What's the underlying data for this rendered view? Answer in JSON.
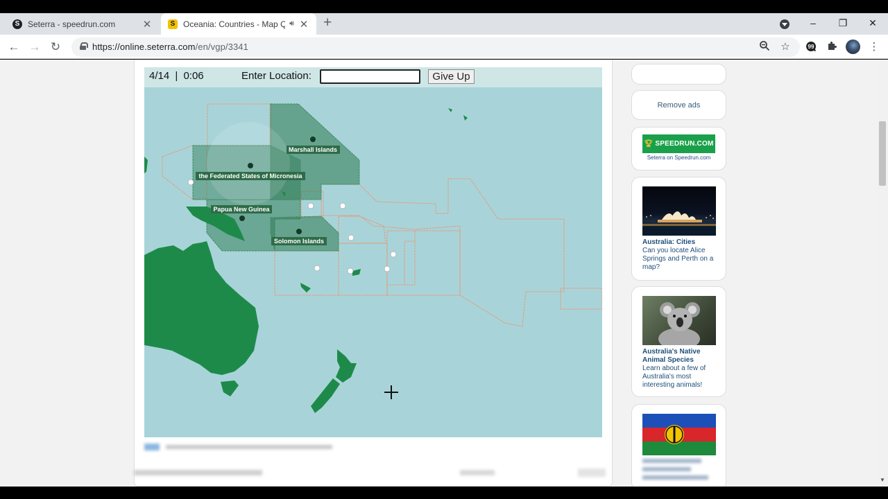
{
  "browser": {
    "tabs": [
      {
        "title": "Seterra - speedrun.com",
        "favicon": "speedrun-favicon-icon",
        "active": false
      },
      {
        "title": "Oceania: Countries - Map Qu",
        "favicon": "seterra-favicon-icon",
        "active": true
      }
    ],
    "url_domain": "https://online.seterra.com",
    "url_path": "/en/vgp/3341",
    "new_tab_glyph": "+",
    "window_controls": [
      "–",
      "❐",
      "✕"
    ]
  },
  "game": {
    "progress": "4/14",
    "separator": "|",
    "timer": "0:06",
    "enter_location_label": "Enter Location:",
    "location_value": "",
    "give_up_label": "Give Up",
    "map": {
      "ocean_color": "#a8d4d9",
      "land_color": "#1e8a4a",
      "answered_fill": "#2e7a52",
      "labels": [
        {
          "name": "Marshall Islands"
        },
        {
          "name": "the Federated States of Micronesia"
        },
        {
          "name": "Papua New Guinea"
        },
        {
          "name": "Solomon Islands"
        }
      ],
      "remaining_targets": 10
    }
  },
  "sidebar": {
    "remove_ads": "Remove ads",
    "speedrun_banner": "SPEEDRUN.COM",
    "speedrun_caption": "Seterra on Speedrun.com",
    "cards": [
      {
        "title": "Australia: Cities",
        "description": "Can you locate Alice Springs and Perth on a map?"
      },
      {
        "title": "Australia's Native Animal Species",
        "description": "Learn about a few of Australia's most interesting animals!"
      }
    ]
  }
}
